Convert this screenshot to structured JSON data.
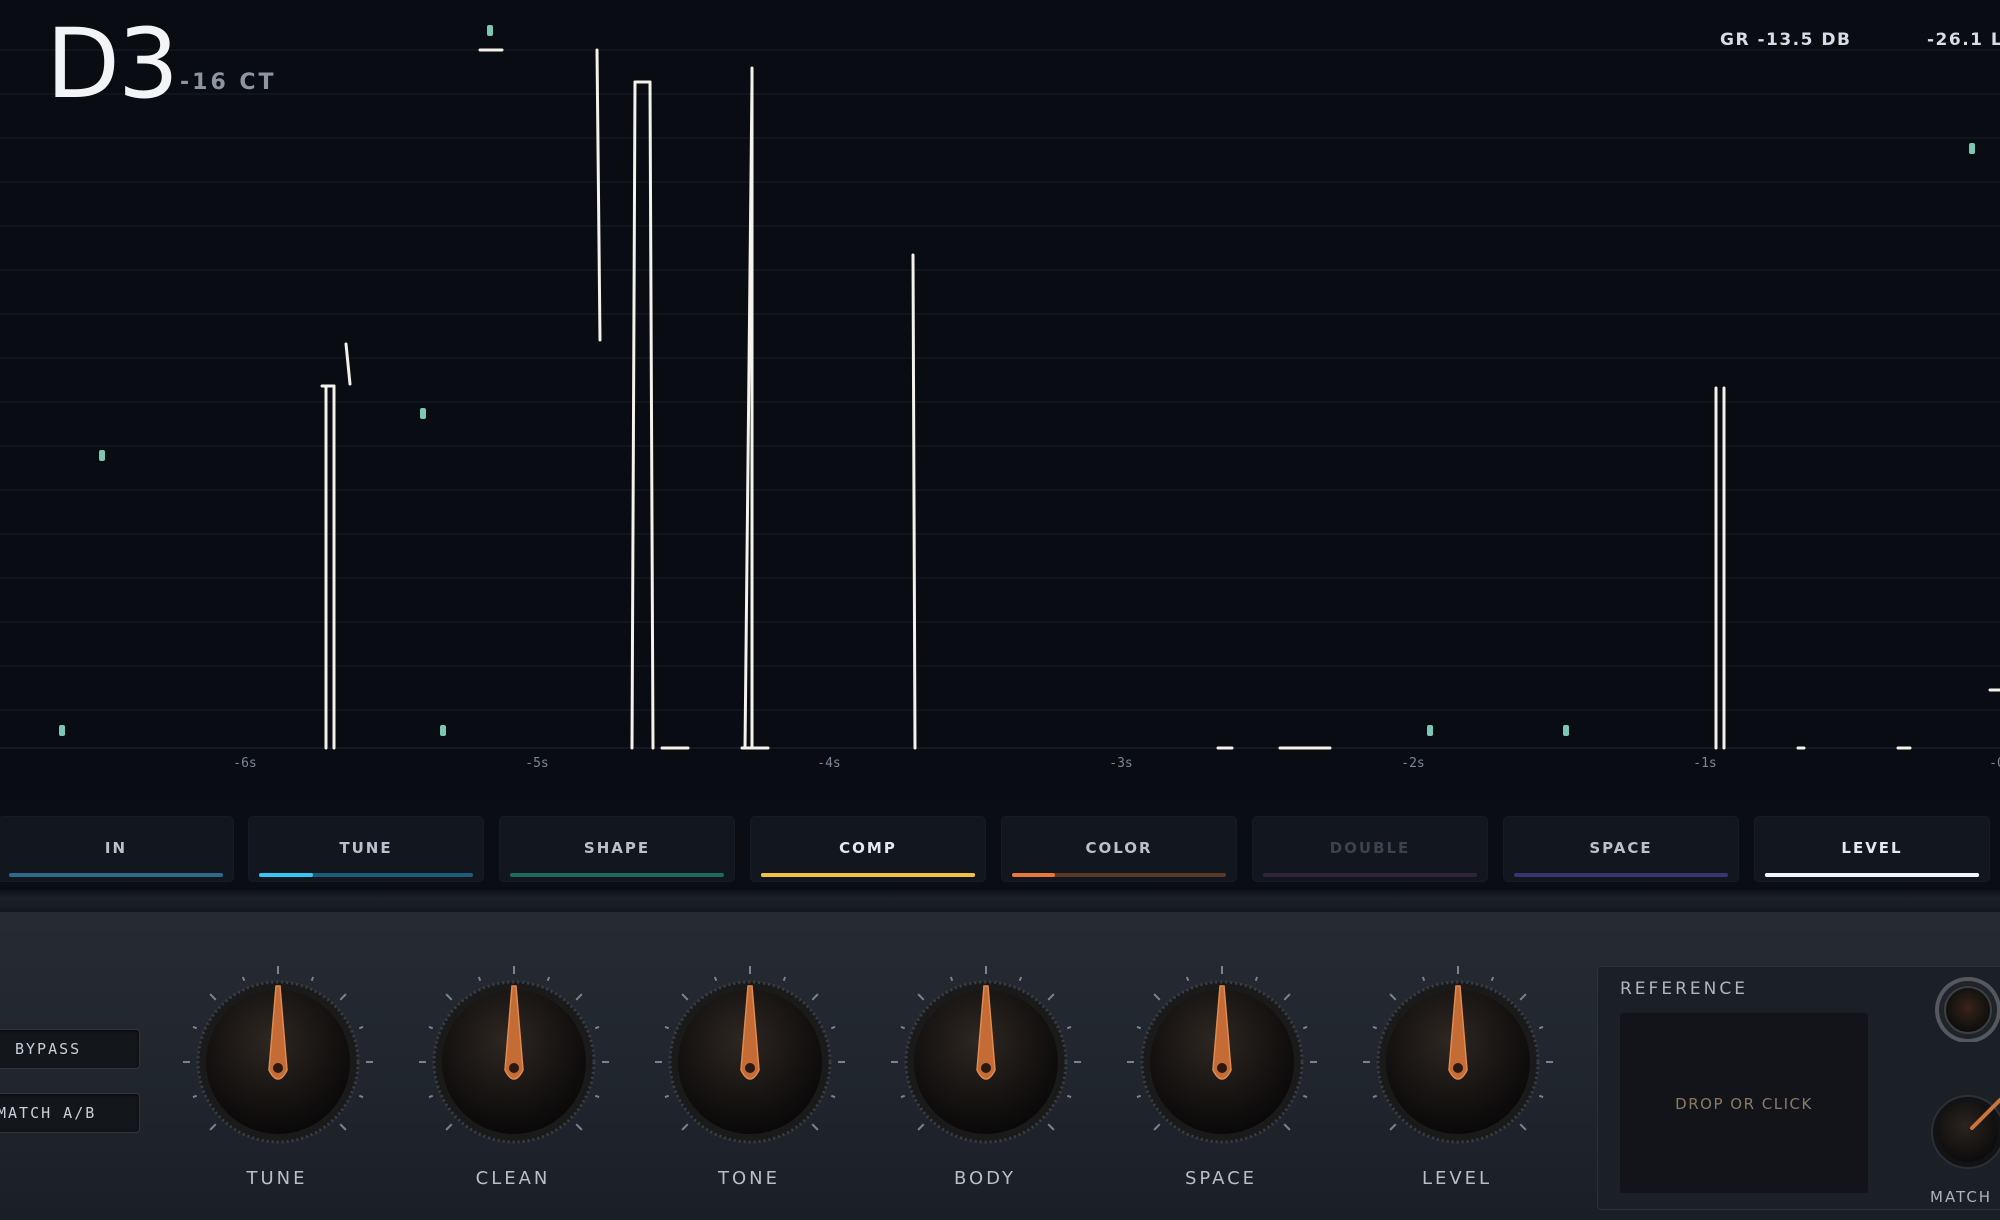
{
  "tuner": {
    "note": "D3",
    "cents": "-16 CT",
    "gain_reduction": "GR -13.5 DB",
    "level_readout": "-26.1 L"
  },
  "timeline": {
    "labels": [
      "-6s",
      "-5s",
      "-4s",
      "-3s",
      "-2s",
      "-1s",
      "-0"
    ]
  },
  "colors": {
    "display_bg": "#090c12",
    "grid": "#171d27",
    "trace": "#f4f2ea",
    "onset_marker": "#8fe8d4"
  },
  "stages": [
    {
      "label": "IN",
      "color": "#2f6a8a",
      "progress": 0.0,
      "fill": "#4fa3d0",
      "dim": false
    },
    {
      "label": "TUNE",
      "color": "#1d5c78",
      "progress": 0.25,
      "fill": "#38c6f0",
      "dim": false
    },
    {
      "label": "SHAPE",
      "color": "#1f6b58",
      "progress": 0.0,
      "fill": "#2fa57f",
      "dim": false
    },
    {
      "label": "COMP",
      "color": "#f0b93a",
      "progress": 1.0,
      "fill": "#f3c044",
      "dim": false
    },
    {
      "label": "COLOR",
      "color": "#5a3a24",
      "progress": 0.2,
      "fill": "#e9783a",
      "dim": false
    },
    {
      "label": "DOUBLE",
      "color": "#2e2638",
      "progress": 0.0,
      "fill": "#4a3d60",
      "dim": true
    },
    {
      "label": "SPACE",
      "color": "#3b3370",
      "progress": 0.0,
      "fill": "#5b4fb0",
      "dim": false
    },
    {
      "label": "LEVEL",
      "color": "#e9eef4",
      "progress": 1.0,
      "fill": "#f2f6fa",
      "dim": false
    }
  ],
  "buttons": {
    "bypass": "BYPASS",
    "match_ab": "MATCH A/B"
  },
  "knobs": [
    {
      "label": "TUNE"
    },
    {
      "label": "CLEAN"
    },
    {
      "label": "TONE"
    },
    {
      "label": "BODY"
    },
    {
      "label": "SPACE"
    },
    {
      "label": "LEVEL"
    }
  ],
  "reference": {
    "title": "REFERENCE",
    "drop_hint": "DROP OR CLICK",
    "match_label": "MATCH"
  }
}
